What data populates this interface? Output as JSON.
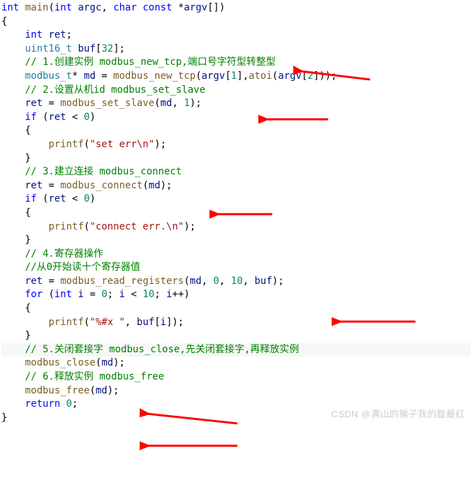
{
  "code": {
    "l1_int": "int",
    "l1_main": "main",
    "l1_int2": "int",
    "l1_argc": "argc",
    "l1_char": "char",
    "l1_const": "const",
    "l1_argv": "argv",
    "l2_brace": "{",
    "l3_int": "int",
    "l3_ret": "ret",
    "l4_type": "uint16_t",
    "l4_buf": "buf",
    "l4_sz": "32",
    "l5_c": "// 1.创建实例 modbus_new_tcp,端口号字符型转整型",
    "l6_type": "modbus_t",
    "l6_md": "md",
    "l6_fn": "modbus_new_tcp",
    "l6_argv": "argv",
    "l6_i1": "1",
    "l6_atoi": "atoi",
    "l6_argv2": "argv",
    "l6_i2": "2",
    "l7_c": "// 2.设置从机id modbus_set_slave",
    "l8_ret": "ret",
    "l8_fn": "modbus_set_slave",
    "l8_md": "md",
    "l8_n": "1",
    "l9_if": "if",
    "l9_ret": "ret",
    "l9_z": "0",
    "l10_b": "{",
    "l11_printf": "printf",
    "l11_s": "\"set err\\n\"",
    "l12_b": "}",
    "l13_c": "// 3.建立连接 modbus_connect",
    "l14_ret": "ret",
    "l14_fn": "modbus_connect",
    "l14_md": "md",
    "l15_if": "if",
    "l15_ret": "ret",
    "l15_z": "0",
    "l16_b": "{",
    "l17_printf": "printf",
    "l17_s": "\"connect err.\\n\"",
    "l18_b": "}",
    "l19_c": "// 4.寄存器操作",
    "l20_c": "//从0开始读十个寄存器值",
    "l21_ret": "ret",
    "l21_fn": "modbus_read_registers",
    "l21_md": "md",
    "l21_a": "0",
    "l21_b2": "10",
    "l21_buf": "buf",
    "l22_for": "for",
    "l22_int": "int",
    "l22_i": "i",
    "l22_z": "0",
    "l22_i2": "i",
    "l22_lt": "10",
    "l22_i3": "i",
    "l23_b": "{",
    "l24_printf": "printf",
    "l24_s": "\"%#x \"",
    "l24_buf": "buf",
    "l24_i": "i",
    "l25_b": "}",
    "l26_c": "// 5.关闭套接字 modbus_close,先关闭套接字,再释放实例",
    "l27_fn": "modbus_close",
    "l27_md": "md",
    "l28_c": "// 6.释放实例 modbus_free",
    "l29_fn": "modbus_free",
    "l29_md": "md",
    "l30_ret": "return",
    "l30_z": "0",
    "l31_b": "}"
  },
  "watermark": "CSDN @满山的猴子我的腚最红"
}
